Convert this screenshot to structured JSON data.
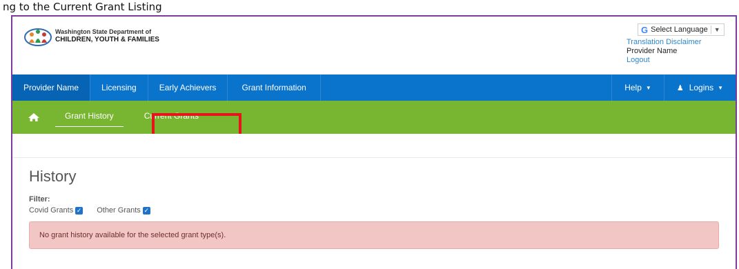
{
  "caption": "ng to the Current Grant Listing",
  "header": {
    "logo_line1": "Washington State Department of",
    "logo_line2": "CHILDREN, YOUTH & FAMILIES",
    "language_select": "Select Language",
    "translation_disclaimer": "Translation Disclaimer",
    "provider_name": "Provider Name",
    "logout": "Logout"
  },
  "primary_nav": {
    "items": [
      {
        "label": "Provider Name",
        "active": true
      },
      {
        "label": "Licensing"
      },
      {
        "label": "Early Achievers"
      },
      {
        "label": "Grant Information"
      }
    ],
    "help": "Help",
    "logins": "Logins"
  },
  "secondary_nav": {
    "items": [
      {
        "label": "Grant History",
        "active": true
      },
      {
        "label": "Current Grants",
        "highlighted": true
      }
    ]
  },
  "page": {
    "title": "History",
    "filter_label": "Filter:",
    "filters": [
      {
        "label": "Covid Grants",
        "checked": true
      },
      {
        "label": "Other Grants",
        "checked": true
      }
    ],
    "alert": "No grant history available for the selected grant type(s)."
  },
  "colors": {
    "primary_nav": "#0a73cc",
    "secondary_nav": "#78b631",
    "highlight": "#e8141b",
    "alert_bg": "#f3c6c6",
    "frame_border": "#7b3aa0"
  }
}
